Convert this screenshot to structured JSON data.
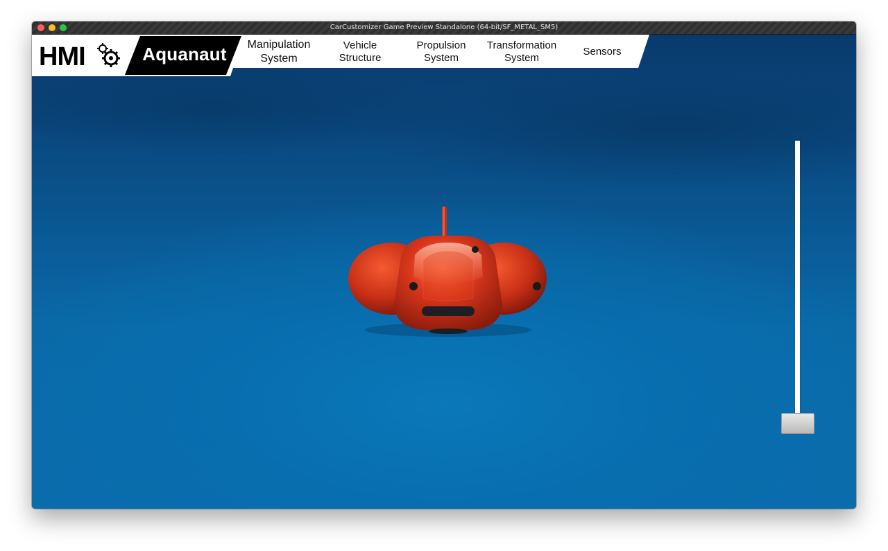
{
  "window": {
    "title": "CarCustomizer Game Preview Standalone (64-bit/SF_METAL_SM5)"
  },
  "header": {
    "logo_text": "HMI",
    "brand": "Aquanaut",
    "nav": [
      {
        "label": "Manipulation\nSystem"
      },
      {
        "label": "Vehicle\nStructure"
      },
      {
        "label": "Propulsion\nSystem"
      },
      {
        "label": "Transformation\nSystem"
      },
      {
        "label": "Sensors"
      }
    ]
  },
  "slider": {
    "value_fraction": 0.0
  },
  "colors": {
    "water_dark": "#093a6c",
    "water_light": "#0a6cab",
    "vehicle_body": "#d9361c",
    "menu_bg": "#ffffff",
    "brand_bg": "#000000"
  },
  "icons": [
    "close-icon",
    "minimize-icon",
    "maximize-icon",
    "gear-icon"
  ]
}
